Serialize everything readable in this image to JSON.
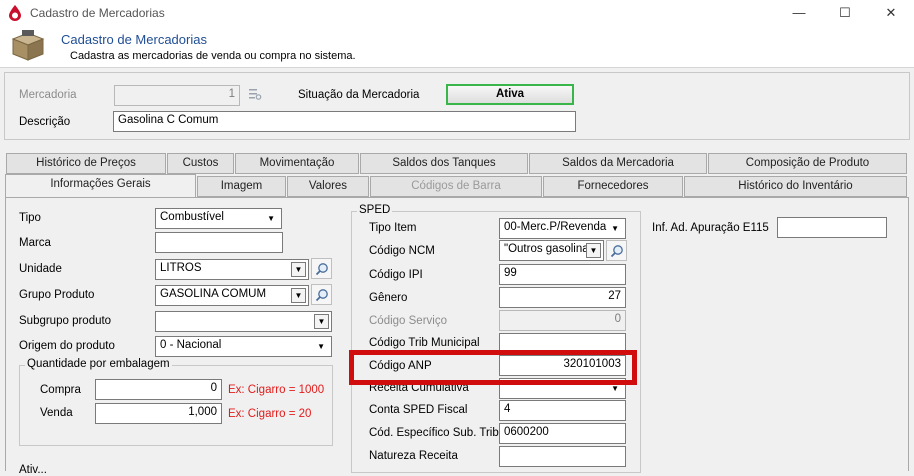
{
  "window": {
    "title": "Cadastro de Mercadorias",
    "minimize": "—",
    "maximize": "☐",
    "close": "✕"
  },
  "header": {
    "title": "Cadastro de Mercadorias",
    "subtitle": "Cadastra as mercadorias de venda ou compra no sistema."
  },
  "top": {
    "mercadoria_label": "Mercadoria",
    "mercadoria_value": "1",
    "situacao_label": "Situação da Mercadoria",
    "situacao_value": "Ativa",
    "descricao_label": "Descrição",
    "descricao_value": "Gasolina C Comum"
  },
  "tabs_row1": [
    "Histórico de Preços",
    "Custos",
    "Movimentação",
    "Saldos dos Tanques",
    "Saldos da Mercadoria",
    "Composição de Produto"
  ],
  "tabs_row2": [
    "Informações Gerais",
    "Imagem",
    "Valores",
    "Códigos de Barra",
    "Fornecedores",
    "Histórico do Inventário"
  ],
  "left": {
    "tipo_label": "Tipo",
    "tipo_value": "Combustível",
    "marca_label": "Marca",
    "marca_value": "",
    "unidade_label": "Unidade",
    "unidade_value": "LITROS",
    "grupo_label": "Grupo Produto",
    "grupo_value": "GASOLINA COMUM",
    "subgrupo_label": "Subgrupo produto",
    "subgrupo_value": "",
    "origem_label": "Origem do produto",
    "origem_value": "0 - Nacional",
    "qtd_group": "Quantidade por embalagem",
    "compra_label": "Compra",
    "compra_value": "0",
    "compra_hint": "Ex: Cigarro = 1000",
    "venda_label": "Venda",
    "venda_value": "1,000",
    "venda_hint": "Ex: Cigarro = 20"
  },
  "sped": {
    "group": "SPED",
    "tipo_item_label": "Tipo Item",
    "tipo_item_value": "00-Merc.P/Revenda",
    "ncm_label": "Código NCM",
    "ncm_value": "\"Outros gasolinas",
    "ipi_label": "Código IPI",
    "ipi_value": "99",
    "genero_label": "Gênero",
    "genero_value": "27",
    "servico_label": "Código Serviço",
    "servico_value": "0",
    "trib_mun_label": "Código Trib Municipal",
    "trib_mun_value": "",
    "anp_label": "Código ANP",
    "anp_value": "320101003",
    "receita_label": "Receita Cumulativa",
    "receita_value": "",
    "conta_label": "Conta SPED Fiscal",
    "conta_value": "4",
    "cod_esp_label": "Cód. Específico Sub. Trib",
    "cod_esp_value": "0600200",
    "natureza_label": "Natureza Receita",
    "natureza_value": "",
    "e115_label": "Inf. Ad. Apuração E115",
    "e115_value": ""
  },
  "bottom_partial": "Ativ..."
}
